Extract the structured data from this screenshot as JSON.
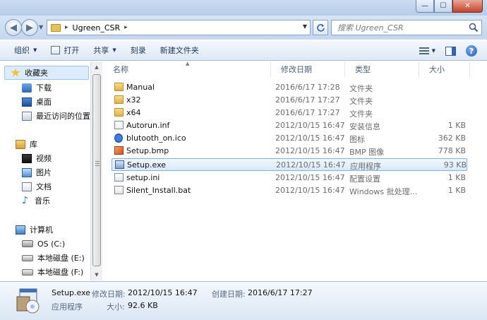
{
  "window": {
    "min_label": "—",
    "max_label": "☐",
    "close_label": "✕"
  },
  "nav": {
    "back_glyph": "◀",
    "forward_glyph": "▶"
  },
  "address": {
    "crumb_sep": "▸",
    "path": "Ugreen_CSR",
    "crumb_sep_end": "▸"
  },
  "search": {
    "placeholder": "搜索 Ugreen_CSR"
  },
  "toolbar": {
    "organize": "组织",
    "open": "打开",
    "share": "共享",
    "burn": "刻录",
    "new_folder": "新建文件夹",
    "help": "?"
  },
  "sidebar": {
    "favorites": "收藏夹",
    "downloads": "下载",
    "desktop": "桌面",
    "recent": "最近访问的位置",
    "libraries": "库",
    "videos": "视频",
    "pictures": "图片",
    "documents": "文档",
    "music": "音乐",
    "computer": "计算机",
    "drive_c": "OS (C:)",
    "drive_e": "本地磁盘 (E:)",
    "drive_f": "本地磁盘 (F:)"
  },
  "columns": {
    "name": "名称",
    "date": "修改日期",
    "type": "类型",
    "size": "大小"
  },
  "files": [
    {
      "name": "Manual",
      "date": "2016/6/17 17:28",
      "type": "文件夹",
      "size": "",
      "icon": "folder-icon"
    },
    {
      "name": "x32",
      "date": "2016/6/17 17:27",
      "type": "文件夹",
      "size": "",
      "icon": "folder-icon"
    },
    {
      "name": "x64",
      "date": "2016/6/17 17:27",
      "type": "文件夹",
      "size": "",
      "icon": "folder-icon"
    },
    {
      "name": "Autorun.inf",
      "date": "2012/10/15 16:47",
      "type": "安装信息",
      "size": "1 KB",
      "icon": "inf-file-icon"
    },
    {
      "name": "blutooth_on.ico",
      "date": "2012/10/15 16:47",
      "type": "图标",
      "size": "362 KB",
      "icon": "bluetooth-icon"
    },
    {
      "name": "Setup.bmp",
      "date": "2012/10/15 16:47",
      "type": "BMP 图像",
      "size": "778 KB",
      "icon": "bmp-file-icon"
    },
    {
      "name": "Setup.exe",
      "date": "2012/10/15 16:47",
      "type": "应用程序",
      "size": "93 KB",
      "icon": "exe-file-icon",
      "selected": true
    },
    {
      "name": "setup.ini",
      "date": "2012/10/15 16:47",
      "type": "配置设置",
      "size": "1 KB",
      "icon": "ini-file-icon"
    },
    {
      "name": "Silent_Install.bat",
      "date": "2012/10/15 16:47",
      "type": "Windows 批处理...",
      "size": "1 KB",
      "icon": "bat-file-icon"
    }
  ],
  "details": {
    "name": "Setup.exe",
    "type": "应用程序",
    "modified_label": "修改日期:",
    "modified_value": "2012/10/15 16:47",
    "created_label": "创建日期:",
    "created_value": "2016/6/17 17:27",
    "size_label": "大小:",
    "size_value": "92.6 KB"
  }
}
